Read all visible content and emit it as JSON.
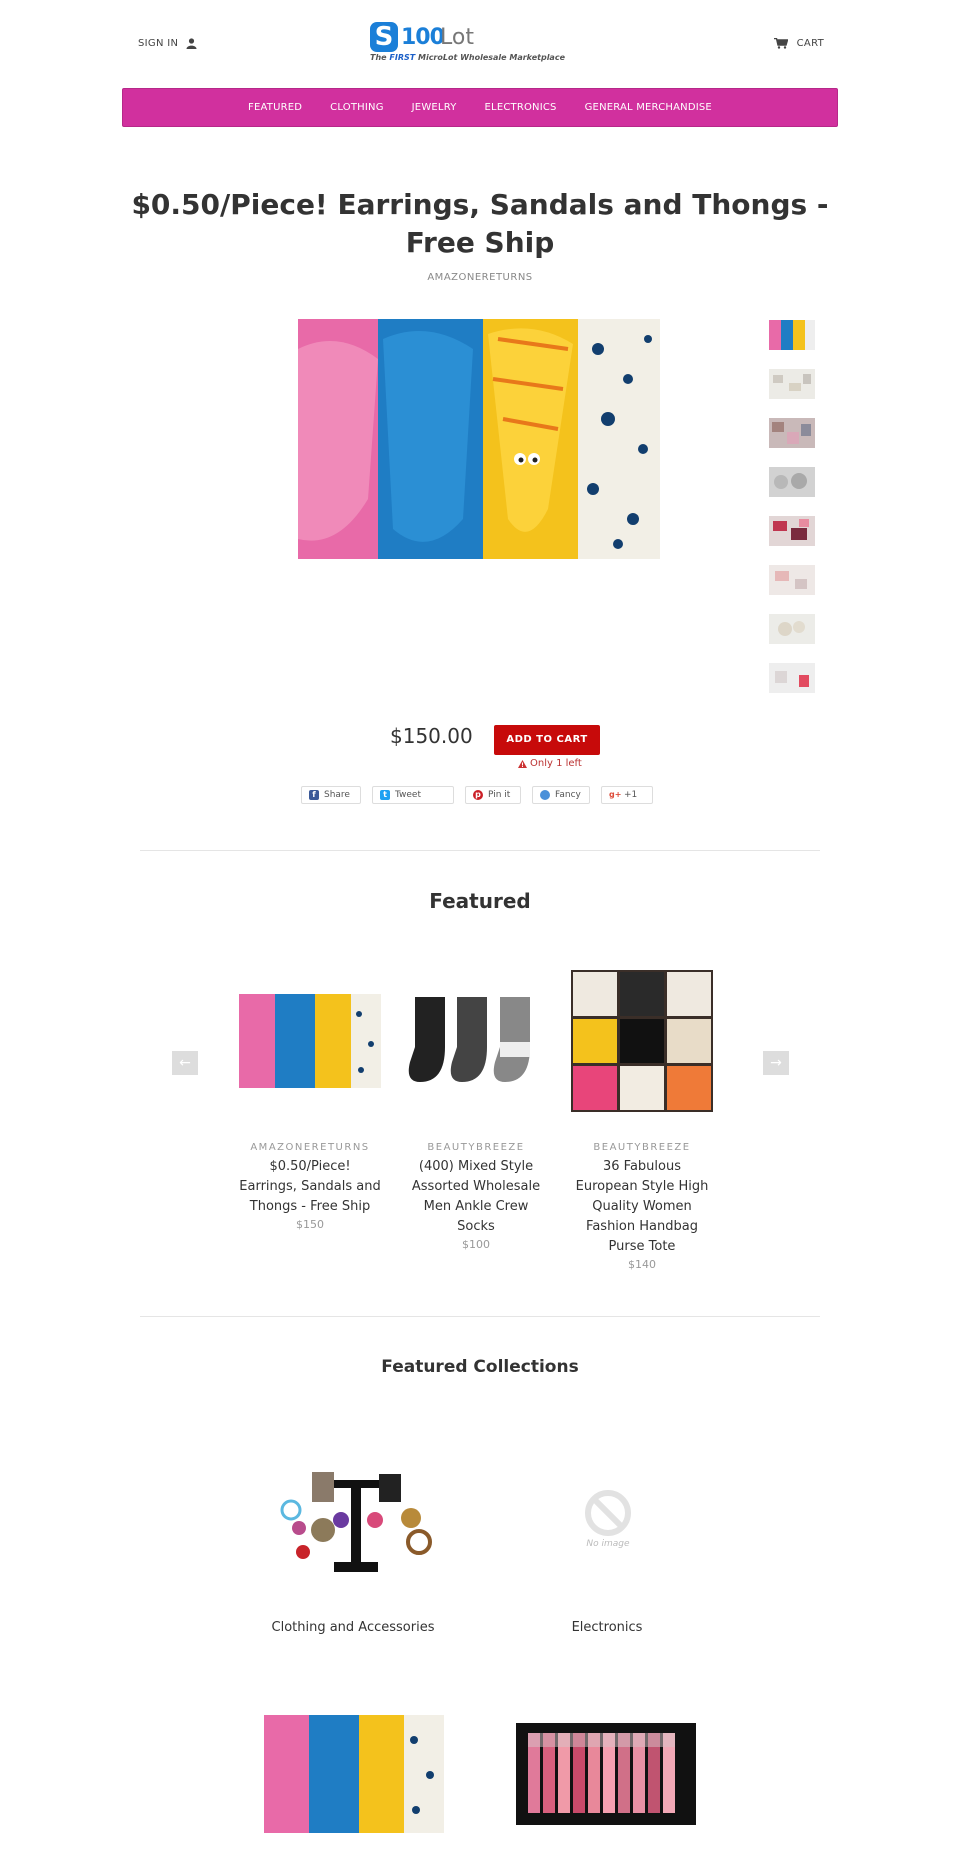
{
  "header": {
    "signin_label": "SIGN IN",
    "cart_label": "CART",
    "logo_letter": "S",
    "logo_num": "100",
    "logo_lot": "Lot",
    "logo_tag_pre": "The ",
    "logo_tag_first": "FIRST",
    "logo_tag_post": " MicroLot Wholesale Marketplace"
  },
  "nav": {
    "items": [
      "FEATURED",
      "CLOTHING",
      "JEWELRY",
      "ELECTRONICS",
      "GENERAL MERCHANDISE"
    ]
  },
  "product": {
    "title": "$0.50/Piece! Earrings, Sandals and Thongs - Free Ship",
    "vendor": "AMAZONERETURNS",
    "price": "$150.00",
    "add_to_cart": "ADD TO CART",
    "stock": "Only 1 left",
    "thumb_count": 8
  },
  "share": {
    "facebook": "Share",
    "twitter": "Tweet",
    "pinterest": "Pin it",
    "fancy": "Fancy",
    "google": "+1"
  },
  "featured": {
    "title": "Featured",
    "items": [
      {
        "vendor": "AMAZONERETURNS",
        "name": "$0.50/Piece! Earrings, Sandals and Thongs - Free Ship",
        "price": "$150"
      },
      {
        "vendor": "BEAUTYBREEZE",
        "name": "(400) Mixed Style Assorted Wholesale Men Ankle Crew Socks",
        "price": "$100"
      },
      {
        "vendor": "BEAUTYBREEZE",
        "name": "36 Fabulous European Style High Quality Women Fashion Handbag Purse Tote",
        "price": "$140"
      }
    ]
  },
  "collections": {
    "title": "Featured Collections",
    "items": [
      {
        "label": "Clothing and Accessories"
      },
      {
        "label": "Electronics"
      }
    ],
    "no_image": "No image"
  },
  "colors": {
    "nav_bg": "#d1309e",
    "add_to_cart_bg": "#c70a0a",
    "logo_blue": "#1b7fd8"
  }
}
